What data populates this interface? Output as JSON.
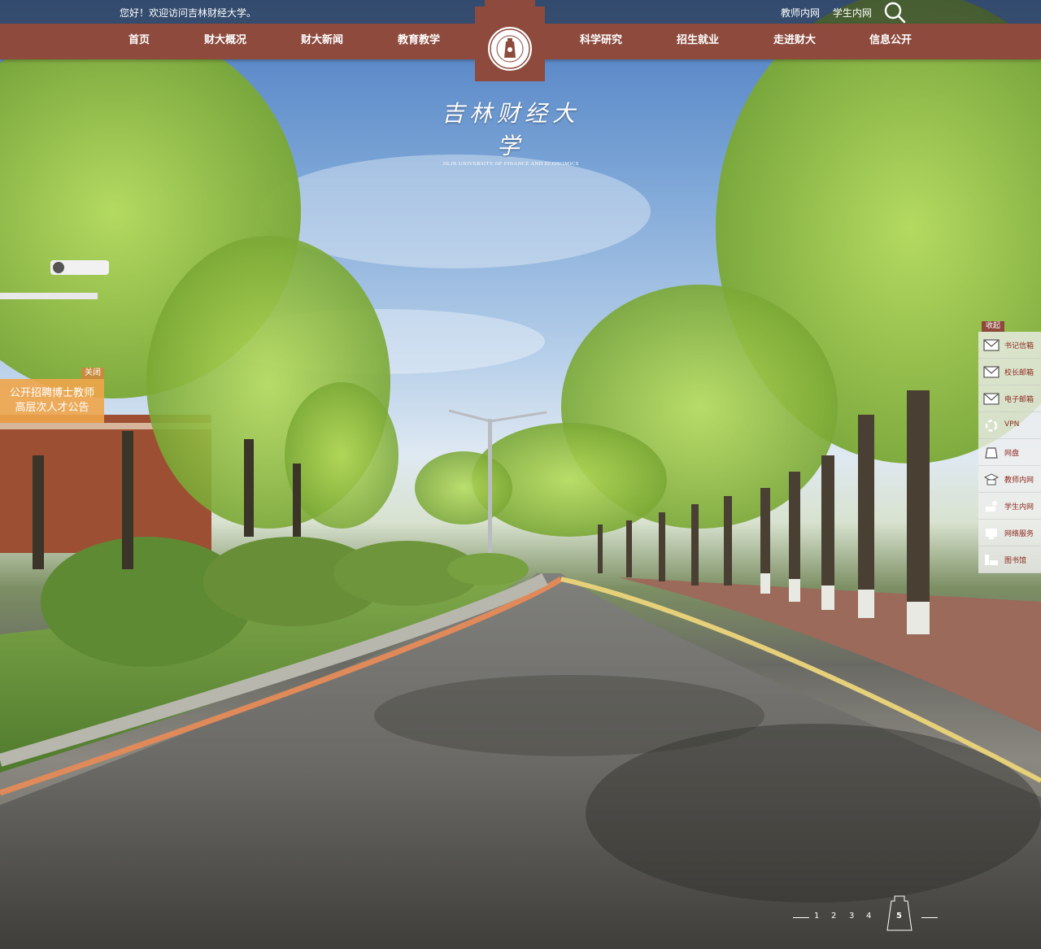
{
  "topbar": {
    "welcome": "您好！欢迎访问吉林财经大学。",
    "links": [
      "教师内网",
      "学生内网"
    ],
    "search_icon": "search-icon"
  },
  "nav": {
    "items": [
      "首页",
      "财大概况",
      "财大新闻",
      "教育教学",
      "科学研究",
      "招生就业",
      "走进财大",
      "信息公开"
    ]
  },
  "logo": {
    "cn": "吉林财经大学",
    "en": "JILIN UNIVERSITY OF FINANCE AND ECONOMICS"
  },
  "recruit": {
    "close": "关闭",
    "line1": "公开招聘博士教师",
    "line2": "高层次人才公告"
  },
  "side": {
    "collapse": "收起",
    "items": [
      {
        "label": "书记信箱",
        "icon": "mail-icon"
      },
      {
        "label": "校长邮箱",
        "icon": "mail-icon"
      },
      {
        "label": "电子邮箱",
        "icon": "mail-icon"
      },
      {
        "label": "VPN",
        "icon": "vpn-icon"
      },
      {
        "label": "网盘",
        "icon": "cloud-disk-icon"
      },
      {
        "label": "教师内网",
        "icon": "teacher-icon"
      },
      {
        "label": "学生内网",
        "icon": "student-icon"
      },
      {
        "label": "网络服务",
        "icon": "network-icon"
      },
      {
        "label": "图书馆",
        "icon": "library-icon"
      }
    ]
  },
  "pager": {
    "pages": [
      "1",
      "2",
      "3",
      "4",
      "5"
    ],
    "active": "5"
  },
  "colors": {
    "brand": "#8d4a3d",
    "recruit": "#f0a54a",
    "side_label": "#8d2a20"
  }
}
